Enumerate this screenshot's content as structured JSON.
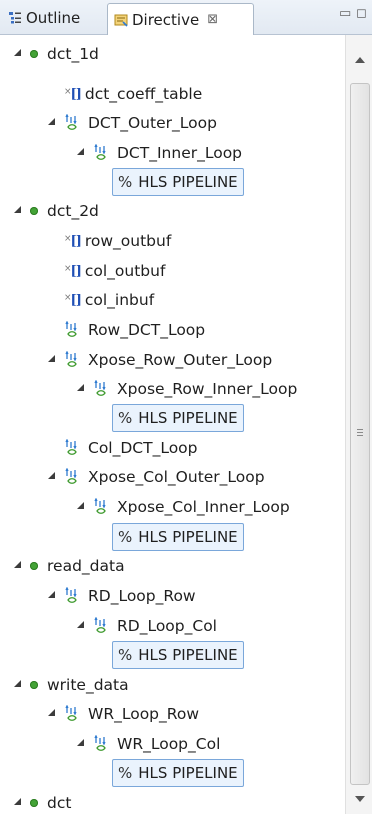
{
  "tabs": {
    "outline": {
      "label": "Outline"
    },
    "directive": {
      "label": "Directive",
      "close": "⊠"
    }
  },
  "view_controls": {
    "minimize": "▭",
    "maximize": "◻"
  },
  "tree": {
    "dct_1d": {
      "label": "dct_1d",
      "dct_coeff_table": "dct_coeff_table",
      "DCT_Outer_Loop": "DCT_Outer_Loop",
      "DCT_Inner_Loop": "DCT_Inner_Loop",
      "pragma": "HLS PIPELINE"
    },
    "dct_2d": {
      "label": "dct_2d",
      "row_outbuf": "row_outbuf",
      "col_outbuf": "col_outbuf",
      "col_inbuf": "col_inbuf",
      "Row_DCT_Loop": "Row_DCT_Loop",
      "Xpose_Row_Outer_Loop": "Xpose_Row_Outer_Loop",
      "Xpose_Row_Inner_Loop": "Xpose_Row_Inner_Loop",
      "pragma_row": "HLS PIPELINE",
      "Col_DCT_Loop": "Col_DCT_Loop",
      "Xpose_Col_Outer_Loop": "Xpose_Col_Outer_Loop",
      "Xpose_Col_Inner_Loop": "Xpose_Col_Inner_Loop",
      "pragma_col": "HLS PIPELINE"
    },
    "read_data": {
      "label": "read_data",
      "RD_Loop_Row": "RD_Loop_Row",
      "RD_Loop_Col": "RD_Loop_Col",
      "pragma": "HLS PIPELINE"
    },
    "write_data": {
      "label": "write_data",
      "WR_Loop_Row": "WR_Loop_Row",
      "WR_Loop_Col": "WR_Loop_Col",
      "pragma": "HLS PIPELINE"
    },
    "dct": {
      "label": "dct"
    }
  },
  "icons": {
    "function": "green-dot-icon",
    "array": "array-icon",
    "loop": "loop-icon",
    "pragma": "percent-icon"
  },
  "colors": {
    "function_dot": "#43a336",
    "array_icon": "#1f4fb5",
    "pragma_border": "#7aa7da",
    "pragma_bg": "#eaf3fd"
  }
}
